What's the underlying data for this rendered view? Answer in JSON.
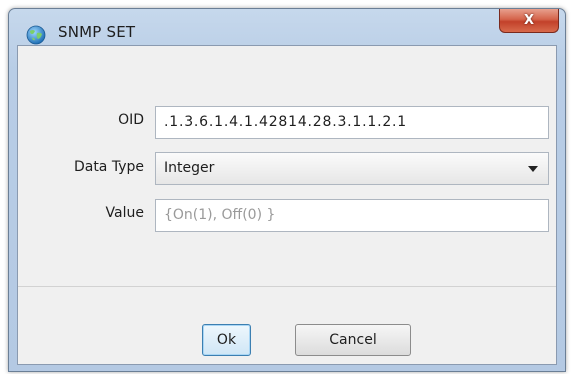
{
  "window": {
    "title": "SNMP SET",
    "close_label": "X"
  },
  "form": {
    "oid_label": "OID",
    "oid_value": ".1.3.6.1.4.1.42814.28.3.1.1.2.1",
    "data_type_label": "Data Type",
    "data_type_selected": "Integer",
    "value_label": "Value",
    "value_placeholder": "{On(1), Off(0) }"
  },
  "buttons": {
    "ok_label": "Ok",
    "cancel_label": "Cancel"
  },
  "colors": {
    "frame": "#b8cde6",
    "client": "#f0f0f0",
    "close_button": "#c2412a"
  }
}
